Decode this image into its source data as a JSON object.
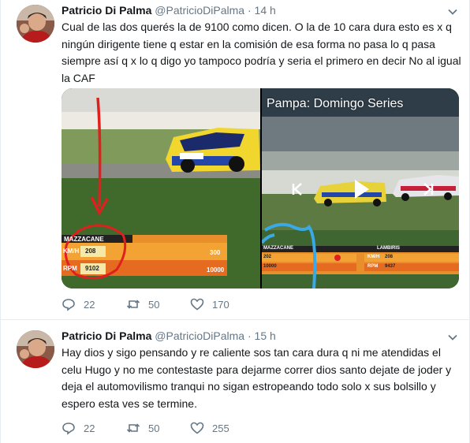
{
  "tweets": [
    {
      "author": "Patricio Di Palma",
      "handle": "@PatricioDiPalma",
      "separator": "·",
      "time": "14 h",
      "text": "Cual de las dos querés la de 9100 como dicen. O la de 10 cara dura esto es x q ningún dirigente tiene q estar en la comisión de esa forma no pasa lo q pasa siempre así q x lo q digo yo tampoco podría y seria el primero en decir No al igual la CAF",
      "media": {
        "left_overlay": {
          "driver": "MAZZACANE",
          "speed_label": "KM/H",
          "speed_value": "208",
          "rpm_label": "RPM",
          "rpm_value": "9102",
          "speed_scale": "300",
          "rpm_scale": "10000"
        },
        "right_video_title": "Pampa: Domingo Series",
        "right_overlay": {
          "driver_left": "MAZZACANE",
          "driver_right": "LAMBIRIS",
          "speed_left": "202",
          "speed_right": "208",
          "rpm_left": "10000",
          "rpm_right": "9437",
          "speed_label": "KM/H",
          "rpm_label": "RPM"
        }
      },
      "replies": "22",
      "retweets": "50",
      "likes": "170"
    },
    {
      "author": "Patricio Di Palma",
      "handle": "@PatricioDiPalma",
      "separator": "·",
      "time": "15 h",
      "text": "Hay dios y sigo pensando y re caliente sos tan cara dura q ni me atendidas el celu Hugo y no me contestaste para dejarme correr dios santo dejate de joder y deja el automovilismo tranqui no sigan estropeando todo solo x sus bolsillo y espero esta ves se termine.",
      "replies": "22",
      "retweets": "50",
      "likes": "255"
    }
  ],
  "colors": {
    "text": "#14171a",
    "secondary": "#657786",
    "divider": "#e6ecf0",
    "annotation_red": "#e0201e",
    "annotation_blue": "#3aa9e8"
  }
}
